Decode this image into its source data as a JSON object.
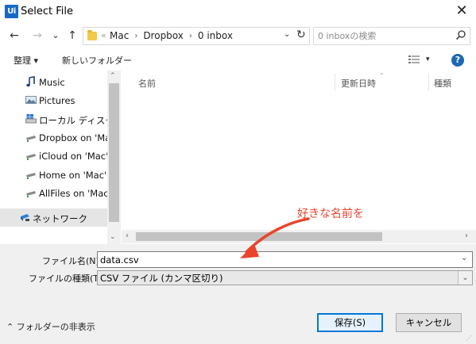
{
  "window": {
    "app_logo": "Ui",
    "title": "Select File",
    "close_glyph": "✕"
  },
  "nav": {
    "back": "←",
    "forward": "→",
    "recent": "⌄",
    "up": "↑",
    "breadcrumb_sep_first": "«",
    "breadcrumbs": [
      "Mac",
      "Dropbox",
      "0 inbox"
    ],
    "crumb_sep": "›",
    "dropdown": "⌄",
    "refresh": "↻",
    "search_placeholder": "0 inboxの検索"
  },
  "toolbar": {
    "organize": "整理 ▾",
    "new_folder": "新しいフォルダー",
    "view_dropdown": "▾",
    "help": "?"
  },
  "sidebar": {
    "items": [
      {
        "label": "Music",
        "icon": "music-note-icon"
      },
      {
        "label": "Pictures",
        "icon": "pictures-icon"
      },
      {
        "label": "ローカル ディスク (C",
        "icon": "local-disk-icon"
      },
      {
        "label": "Dropbox on 'Ma",
        "icon": "network-drive-icon"
      },
      {
        "label": "iCloud on 'Mac'",
        "icon": "network-drive-icon"
      },
      {
        "label": "Home on 'Mac' (",
        "icon": "network-drive-icon"
      },
      {
        "label": "AllFiles on 'Mac'",
        "icon": "network-drive-icon"
      },
      {
        "label": "ネットワーク",
        "icon": "network-icon"
      }
    ],
    "scroll_up": "⌃",
    "scroll_down": "⌄"
  },
  "filelist": {
    "columns": [
      "名前",
      "更新日時",
      "種類"
    ],
    "sort_caret": "⌄",
    "scroll_left": "‹",
    "scroll_right": "›"
  },
  "filename": {
    "label": "ファイル名(N):",
    "value": "data.csv",
    "dropdown": "⌄"
  },
  "filetype": {
    "label": "ファイルの種類(T):",
    "value": "CSV ファイル (カンマ区切り)",
    "dropdown": "⌄"
  },
  "footer": {
    "hide_folders": "⌃ フォルダーの非表示",
    "save": "保存(S)",
    "cancel": "キャンセル",
    "grip": "⋰"
  },
  "annotation": {
    "text": "好きな名前を",
    "color": "#e8452c"
  }
}
